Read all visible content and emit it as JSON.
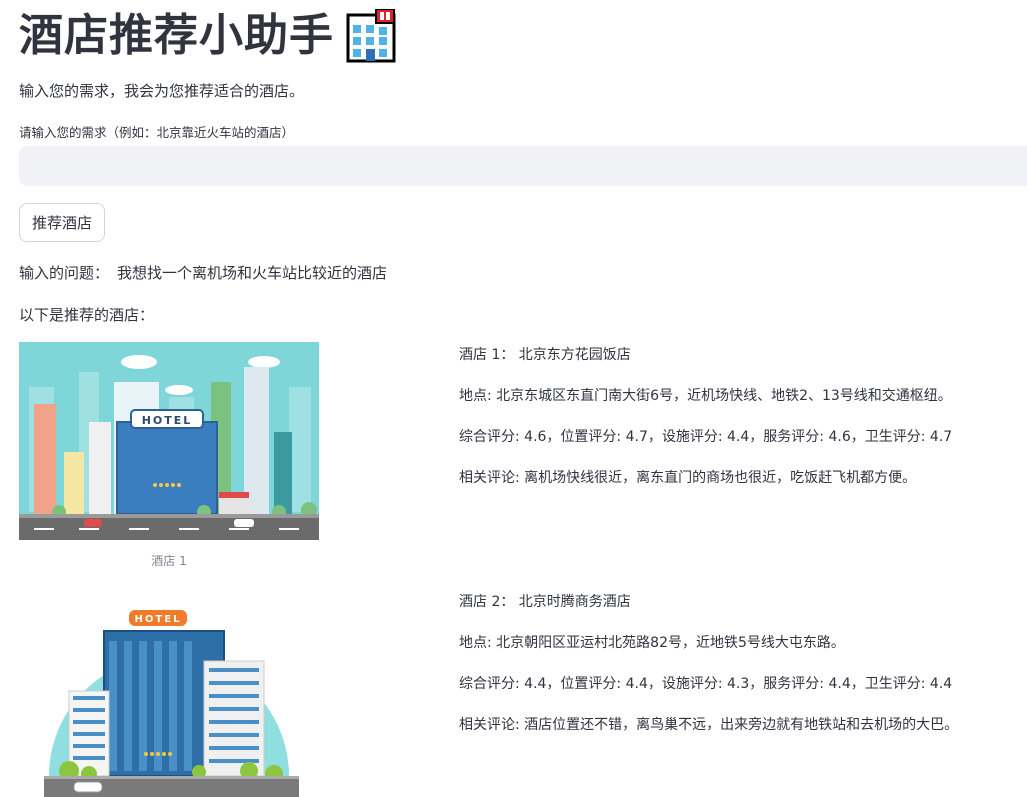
{
  "page": {
    "title": "酒店推荐小助手",
    "subtitle": "输入您的需求，我会为您推荐适合的酒店。"
  },
  "input": {
    "label": "请输入您的需求（例如：北京靠近火车站的酒店）",
    "value": "",
    "placeholder": ""
  },
  "button": {
    "label": "推荐酒店"
  },
  "question": {
    "label": "输入的问题：",
    "text": "我想找一个离机场和火车站比较近的酒店"
  },
  "results_heading": "以下是推荐的酒店：",
  "hotels": [
    {
      "caption": "酒店 1",
      "sign": "HOTEL",
      "name_line": "酒店 1： 北京东方花园饭店",
      "address_line": "地点: 北京东城区东直门南大街6号，近机场快线、地铁2、13号线和交通枢纽。",
      "ratings_line": "综合评分: 4.6，位置评分: 4.7，设施评分: 4.4，服务评分: 4.6，卫生评分: 4.7",
      "review_line": "相关评论: 离机场快线很近，离东直门的商场也很近，吃饭赶飞机都方便。"
    },
    {
      "sign": "HOTEL",
      "name_line": "酒店 2： 北京时腾商务酒店",
      "address_line": "地点: 北京朝阳区亚运村北苑路82号，近地铁5号线大屯东路。",
      "ratings_line": "综合评分: 4.4，位置评分: 4.4，设施评分: 4.3，服务评分: 4.4，卫生评分: 4.4",
      "review_line": "相关评论: 酒店位置还不错，离鸟巢不远，出来旁边就有地铁站和去机场的大巴。"
    }
  ],
  "icons": {
    "title_icon": "hotel-emoji-icon"
  },
  "colors": {
    "text": "#31333f",
    "input_bg": "#f0f2f6",
    "caption": "#808495"
  }
}
